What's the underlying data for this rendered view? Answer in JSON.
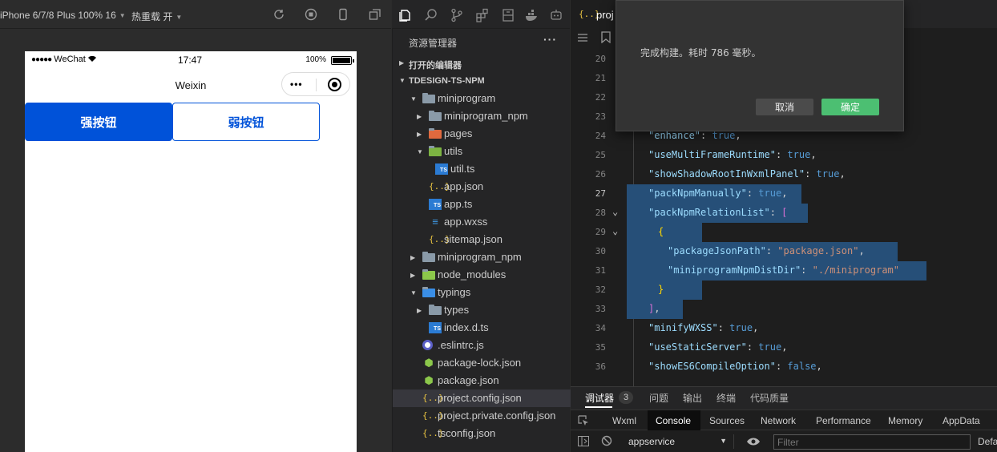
{
  "simulator": {
    "device_label": "iPhone 6/7/8 Plus 100% 16",
    "hot_reload_label": "热重载 开",
    "status": {
      "carrier": "WeChat",
      "signal": "●●●●●",
      "time": "17:47",
      "battery": "100%"
    },
    "nav_title": "Weixin",
    "capsule_more": "•••",
    "buttons": {
      "strong": "强按钮",
      "weak": "弱按钮"
    }
  },
  "explorer": {
    "title": "资源管理器",
    "more": "···",
    "open_editors": "打开的编辑器",
    "project": "TDESIGN-TS-NPM",
    "tree": [
      {
        "name": "miniprogram",
        "type": "folder-open",
        "depth": 1,
        "twisty": "▾"
      },
      {
        "name": "miniprogram_npm",
        "type": "folder",
        "depth": 2,
        "twisty": "▸"
      },
      {
        "name": "pages",
        "type": "folder-pages",
        "depth": 2,
        "twisty": "▸"
      },
      {
        "name": "utils",
        "type": "folder-utils",
        "depth": 2,
        "twisty": "▾"
      },
      {
        "name": "util.ts",
        "type": "ts",
        "depth": 3,
        "twisty": ""
      },
      {
        "name": "app.json",
        "type": "json",
        "depth": 2,
        "twisty": ""
      },
      {
        "name": "app.ts",
        "type": "ts",
        "depth": 2,
        "twisty": ""
      },
      {
        "name": "app.wxss",
        "type": "css",
        "depth": 2,
        "twisty": ""
      },
      {
        "name": "sitemap.json",
        "type": "json",
        "depth": 2,
        "twisty": ""
      },
      {
        "name": "miniprogram_npm",
        "type": "folder",
        "depth": 1,
        "twisty": "▸"
      },
      {
        "name": "node_modules",
        "type": "folder-node",
        "depth": 1,
        "twisty": "▸"
      },
      {
        "name": "typings",
        "type": "folder-ts",
        "depth": 1,
        "twisty": "▾"
      },
      {
        "name": "types",
        "type": "folder",
        "depth": 2,
        "twisty": "▸"
      },
      {
        "name": "index.d.ts",
        "type": "ts",
        "depth": 2,
        "twisty": ""
      },
      {
        "name": ".eslintrc.js",
        "type": "eslint",
        "depth": 1,
        "twisty": ""
      },
      {
        "name": "package-lock.json",
        "type": "node",
        "depth": 1,
        "twisty": ""
      },
      {
        "name": "package.json",
        "type": "node",
        "depth": 1,
        "twisty": ""
      },
      {
        "name": "project.config.json",
        "type": "json",
        "depth": 1,
        "twisty": "",
        "selected": true
      },
      {
        "name": "project.private.config.json",
        "type": "json",
        "depth": 1,
        "twisty": ""
      },
      {
        "name": "tsconfig.json",
        "type": "json",
        "depth": 1,
        "twisty": ""
      }
    ]
  },
  "editor": {
    "tab_label": "proj",
    "lines": [
      {
        "n": "20",
        "tokens": []
      },
      {
        "n": "21",
        "tokens": []
      },
      {
        "n": "22",
        "tokens": []
      },
      {
        "n": "23",
        "tokens": []
      },
      {
        "n": "24",
        "tokens": [
          [
            "k",
            "\"enhance\""
          ],
          [
            "p",
            ": "
          ],
          [
            "bool",
            "true"
          ],
          [
            "p",
            ","
          ]
        ]
      },
      {
        "n": "25",
        "tokens": [
          [
            "k",
            "\"useMultiFrameRuntime\""
          ],
          [
            "p",
            ": "
          ],
          [
            "bool",
            "true"
          ],
          [
            "p",
            ","
          ]
        ]
      },
      {
        "n": "26",
        "tokens": [
          [
            "k",
            "\"showShadowRootInWxmlPanel\""
          ],
          [
            "p",
            ": "
          ],
          [
            "bool",
            "true"
          ],
          [
            "p",
            ","
          ]
        ]
      },
      {
        "n": "27",
        "active": true,
        "sel": 188,
        "tokens": [
          [
            "k",
            "\"packNpmManually\""
          ],
          [
            "p",
            ": "
          ],
          [
            "bool",
            "true"
          ],
          [
            "p",
            ","
          ]
        ]
      },
      {
        "n": "28",
        "fold": true,
        "sel": 196,
        "tokens": [
          [
            "k",
            "\"packNpmRelationList\""
          ],
          [
            "p",
            ": "
          ],
          [
            "br2",
            "["
          ]
        ]
      },
      {
        "n": "29",
        "fold": true,
        "sel": 52,
        "indent": 1,
        "tokens": [
          [
            "b",
            "{"
          ]
        ]
      },
      {
        "n": "30",
        "sel": 284,
        "indent": 2,
        "tokens": [
          [
            "k",
            "\"packageJsonPath\""
          ],
          [
            "p",
            ": "
          ],
          [
            "s",
            "\"package.json\""
          ],
          [
            "p",
            ","
          ]
        ]
      },
      {
        "n": "31",
        "sel": 320,
        "indent": 2,
        "tokens": [
          [
            "k",
            "\"miniprogramNpmDistDir\""
          ],
          [
            "p",
            ": "
          ],
          [
            "s",
            "\"./miniprogram\""
          ]
        ]
      },
      {
        "n": "32",
        "sel": 52,
        "indent": 1,
        "tokens": [
          [
            "b",
            "}"
          ]
        ]
      },
      {
        "n": "33",
        "sel": 40,
        "tokens": [
          [
            "br2",
            "]"
          ],
          [
            "p",
            ","
          ]
        ]
      },
      {
        "n": "34",
        "tokens": [
          [
            "k",
            "\"minifyWXSS\""
          ],
          [
            "p",
            ": "
          ],
          [
            "bool",
            "true"
          ],
          [
            "p",
            ","
          ]
        ]
      },
      {
        "n": "35",
        "tokens": [
          [
            "k",
            "\"useStaticServer\""
          ],
          [
            "p",
            ": "
          ],
          [
            "bool",
            "true"
          ],
          [
            "p",
            ","
          ]
        ]
      },
      {
        "n": "36",
        "tokens": [
          [
            "k",
            "\"showES6CompileOption\""
          ],
          [
            "p",
            ": "
          ],
          [
            "bool",
            "false"
          ],
          [
            "p",
            ","
          ]
        ]
      }
    ]
  },
  "dialog": {
    "message": "完成构建。耗时 786 毫秒。",
    "cancel": "取消",
    "ok": "确定"
  },
  "debug": {
    "tabs": [
      "调试器",
      "问题",
      "输出",
      "终端",
      "代码质量"
    ],
    "badge": "3",
    "devtools_tabs": [
      "Wxml",
      "Console",
      "Sources",
      "Network",
      "Performance",
      "Memory",
      "AppData"
    ],
    "context": "appservice",
    "filter_placeholder": "Filter",
    "levels": "Defa"
  },
  "colors": {
    "primary": "#0052d9",
    "ok_button": "#4cbf72",
    "selection": "#264f78"
  }
}
